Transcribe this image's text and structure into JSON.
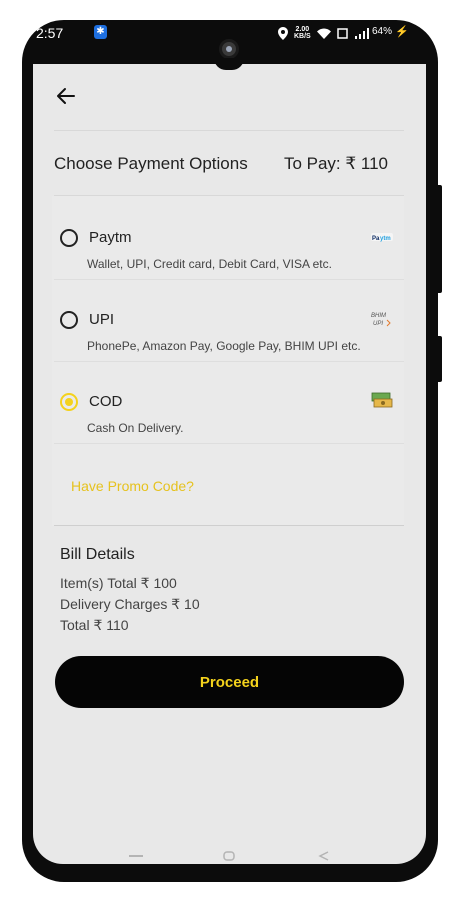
{
  "status_bar": {
    "time": "2:57",
    "network_speed": "2.00\nKB/S",
    "battery": "64%",
    "icons": [
      "bluetooth-icon",
      "location-icon",
      "wifi-icon",
      "signal-icon",
      "battery-charging-icon"
    ]
  },
  "header": {
    "back_icon": "arrow-left-icon"
  },
  "payment": {
    "title": "Choose Payment Options",
    "to_pay": "To Pay: ₹ 110",
    "options": [
      {
        "name": "Paytm",
        "description": "Wallet, UPI, Credit card, Debit Card, VISA etc.",
        "selected": false,
        "logo": "paytm-logo"
      },
      {
        "name": "UPI",
        "description": "PhonePe, Amazon Pay, Google Pay, BHIM UPI etc.",
        "selected": false,
        "logo": "bhim-upi-logo"
      },
      {
        "name": "COD",
        "description": "Cash On Delivery.",
        "selected": true,
        "logo": "cash-icon"
      }
    ],
    "promo": "Have Promo Code?"
  },
  "bill": {
    "title": "Bill Details",
    "items_total": "Item(s) Total ₹ 100",
    "delivery": "Delivery Charges ₹ 10",
    "total": "Total ₹ 110"
  },
  "proceed_label": "Proceed",
  "colors": {
    "accent": "#f4d21c",
    "button_bg": "#050505",
    "screen_bg": "#e8e8e8",
    "phone_frame": "#0c0c0c"
  }
}
